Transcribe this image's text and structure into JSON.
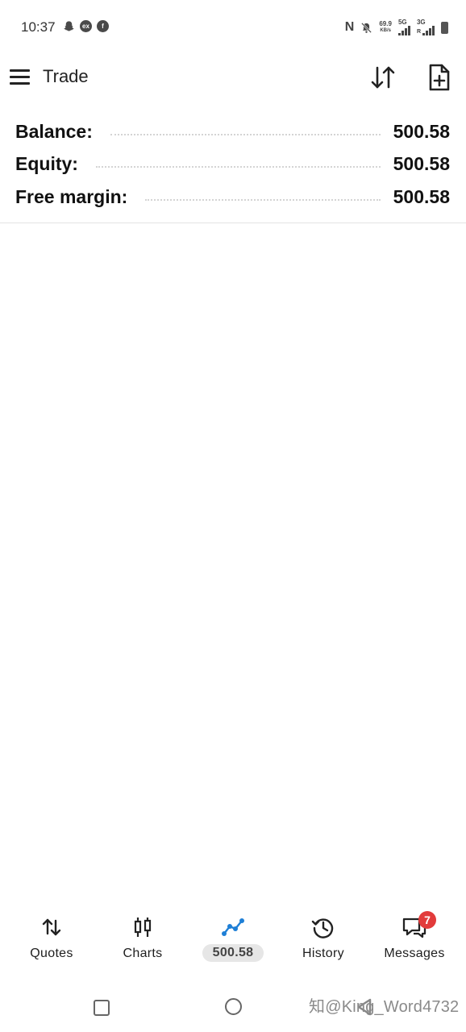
{
  "status_bar": {
    "time": "10:37",
    "left_icons": [
      "snapchat-icon",
      "ex-icon",
      "facebook-icon"
    ],
    "ex_text": "ex",
    "nfc": "N",
    "speed_value": "69.9",
    "speed_unit": "KB/s",
    "net1": "5G",
    "net2": "3G",
    "net2_sub": "R"
  },
  "app_bar": {
    "title": "Trade",
    "menu_icon": "hamburger-menu-icon",
    "sort_icon": "sort-arrows-icon",
    "new_order_icon": "new-document-plus-icon"
  },
  "summary": {
    "balance_label": "Balance:",
    "balance_value": "500.58",
    "equity_label": "Equity:",
    "equity_value": "500.58",
    "free_margin_label": "Free margin:",
    "free_margin_value": "500.58"
  },
  "bottom_nav": {
    "quotes": "Quotes",
    "charts": "Charts",
    "trade": "500.58",
    "history": "History",
    "messages": "Messages",
    "messages_badge": "7",
    "active_color": "#1e7fd6"
  },
  "system_nav": {
    "watermark": "知@King_Word4732"
  }
}
